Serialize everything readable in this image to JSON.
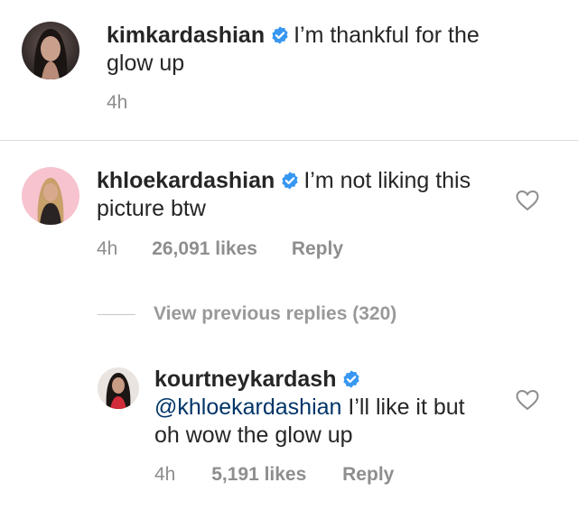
{
  "comments": [
    {
      "username": "kimkardashian",
      "verified": true,
      "text": "I’m thankful for the glow up",
      "time": "4h",
      "avatar_icon": "avatar-kimkardashian"
    },
    {
      "username": "khloekardashian",
      "verified": true,
      "text": "I’m not liking this picture btw",
      "time": "4h",
      "likes": "26,091 likes",
      "reply_label": "Reply",
      "avatar_icon": "avatar-khloekardashian"
    }
  ],
  "view_previous_replies": "View previous replies (320)",
  "replies": [
    {
      "username": "kourtneykardash",
      "verified": true,
      "mention": "@khloekardashian",
      "text": "I’ll like it but oh wow the glow up",
      "time": "4h",
      "likes": "5,191 likes",
      "reply_label": "Reply",
      "avatar_icon": "avatar-kourtneykardash"
    }
  ],
  "colors": {
    "text": "#262626",
    "meta": "#8e8e8e",
    "verified_badge": "#3897f0",
    "mention": "#003569",
    "divider": "#dbdbdb"
  },
  "icons": [
    "verified-badge-icon",
    "heart-icon"
  ]
}
